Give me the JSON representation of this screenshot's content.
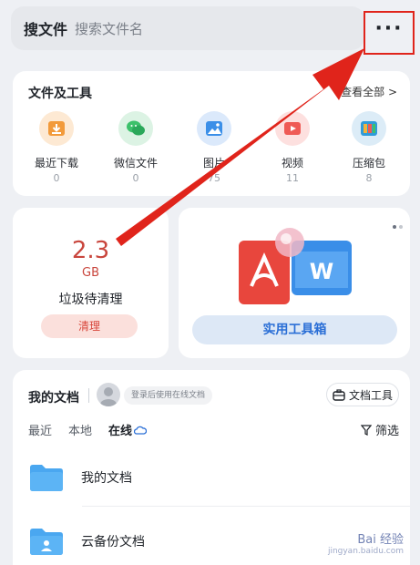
{
  "search": {
    "title": "搜文件",
    "placeholder": "搜索文件名",
    "more": "···"
  },
  "tools": {
    "header": "文件及工具",
    "see_all": "查看全部 >",
    "items": [
      {
        "label": "最近下载",
        "count": "0",
        "icon": "download-icon",
        "color": "#f29a3a"
      },
      {
        "label": "微信文件",
        "count": "0",
        "icon": "wechat-icon",
        "color": "#3cc16b"
      },
      {
        "label": "图片",
        "count": "75",
        "icon": "image-icon",
        "color": "#3b8fe8"
      },
      {
        "label": "视频",
        "count": "11",
        "icon": "video-icon",
        "color": "#ef5a55"
      },
      {
        "label": "压缩包",
        "count": "8",
        "icon": "zip-icon",
        "color": "#2f9bd9"
      }
    ]
  },
  "junk": {
    "size": "2.3",
    "unit": "GB",
    "label": "垃圾待清理",
    "button": "清理"
  },
  "toolbox": {
    "button": "实用工具箱"
  },
  "docs": {
    "title": "我的文档",
    "login_hint": "登录后使用在线文档",
    "tools_button": "文档工具",
    "tabs": [
      "最近",
      "本地",
      "在线"
    ],
    "filter": "筛选",
    "folders": [
      "我的文档",
      "云备份文档"
    ]
  },
  "watermark": {
    "main": "Bai 经验",
    "sub": "jingyan.baidu.com"
  },
  "colors": {
    "annotation": "#e0241b",
    "accent": "#2b6fd6",
    "junk": "#c9463d"
  }
}
